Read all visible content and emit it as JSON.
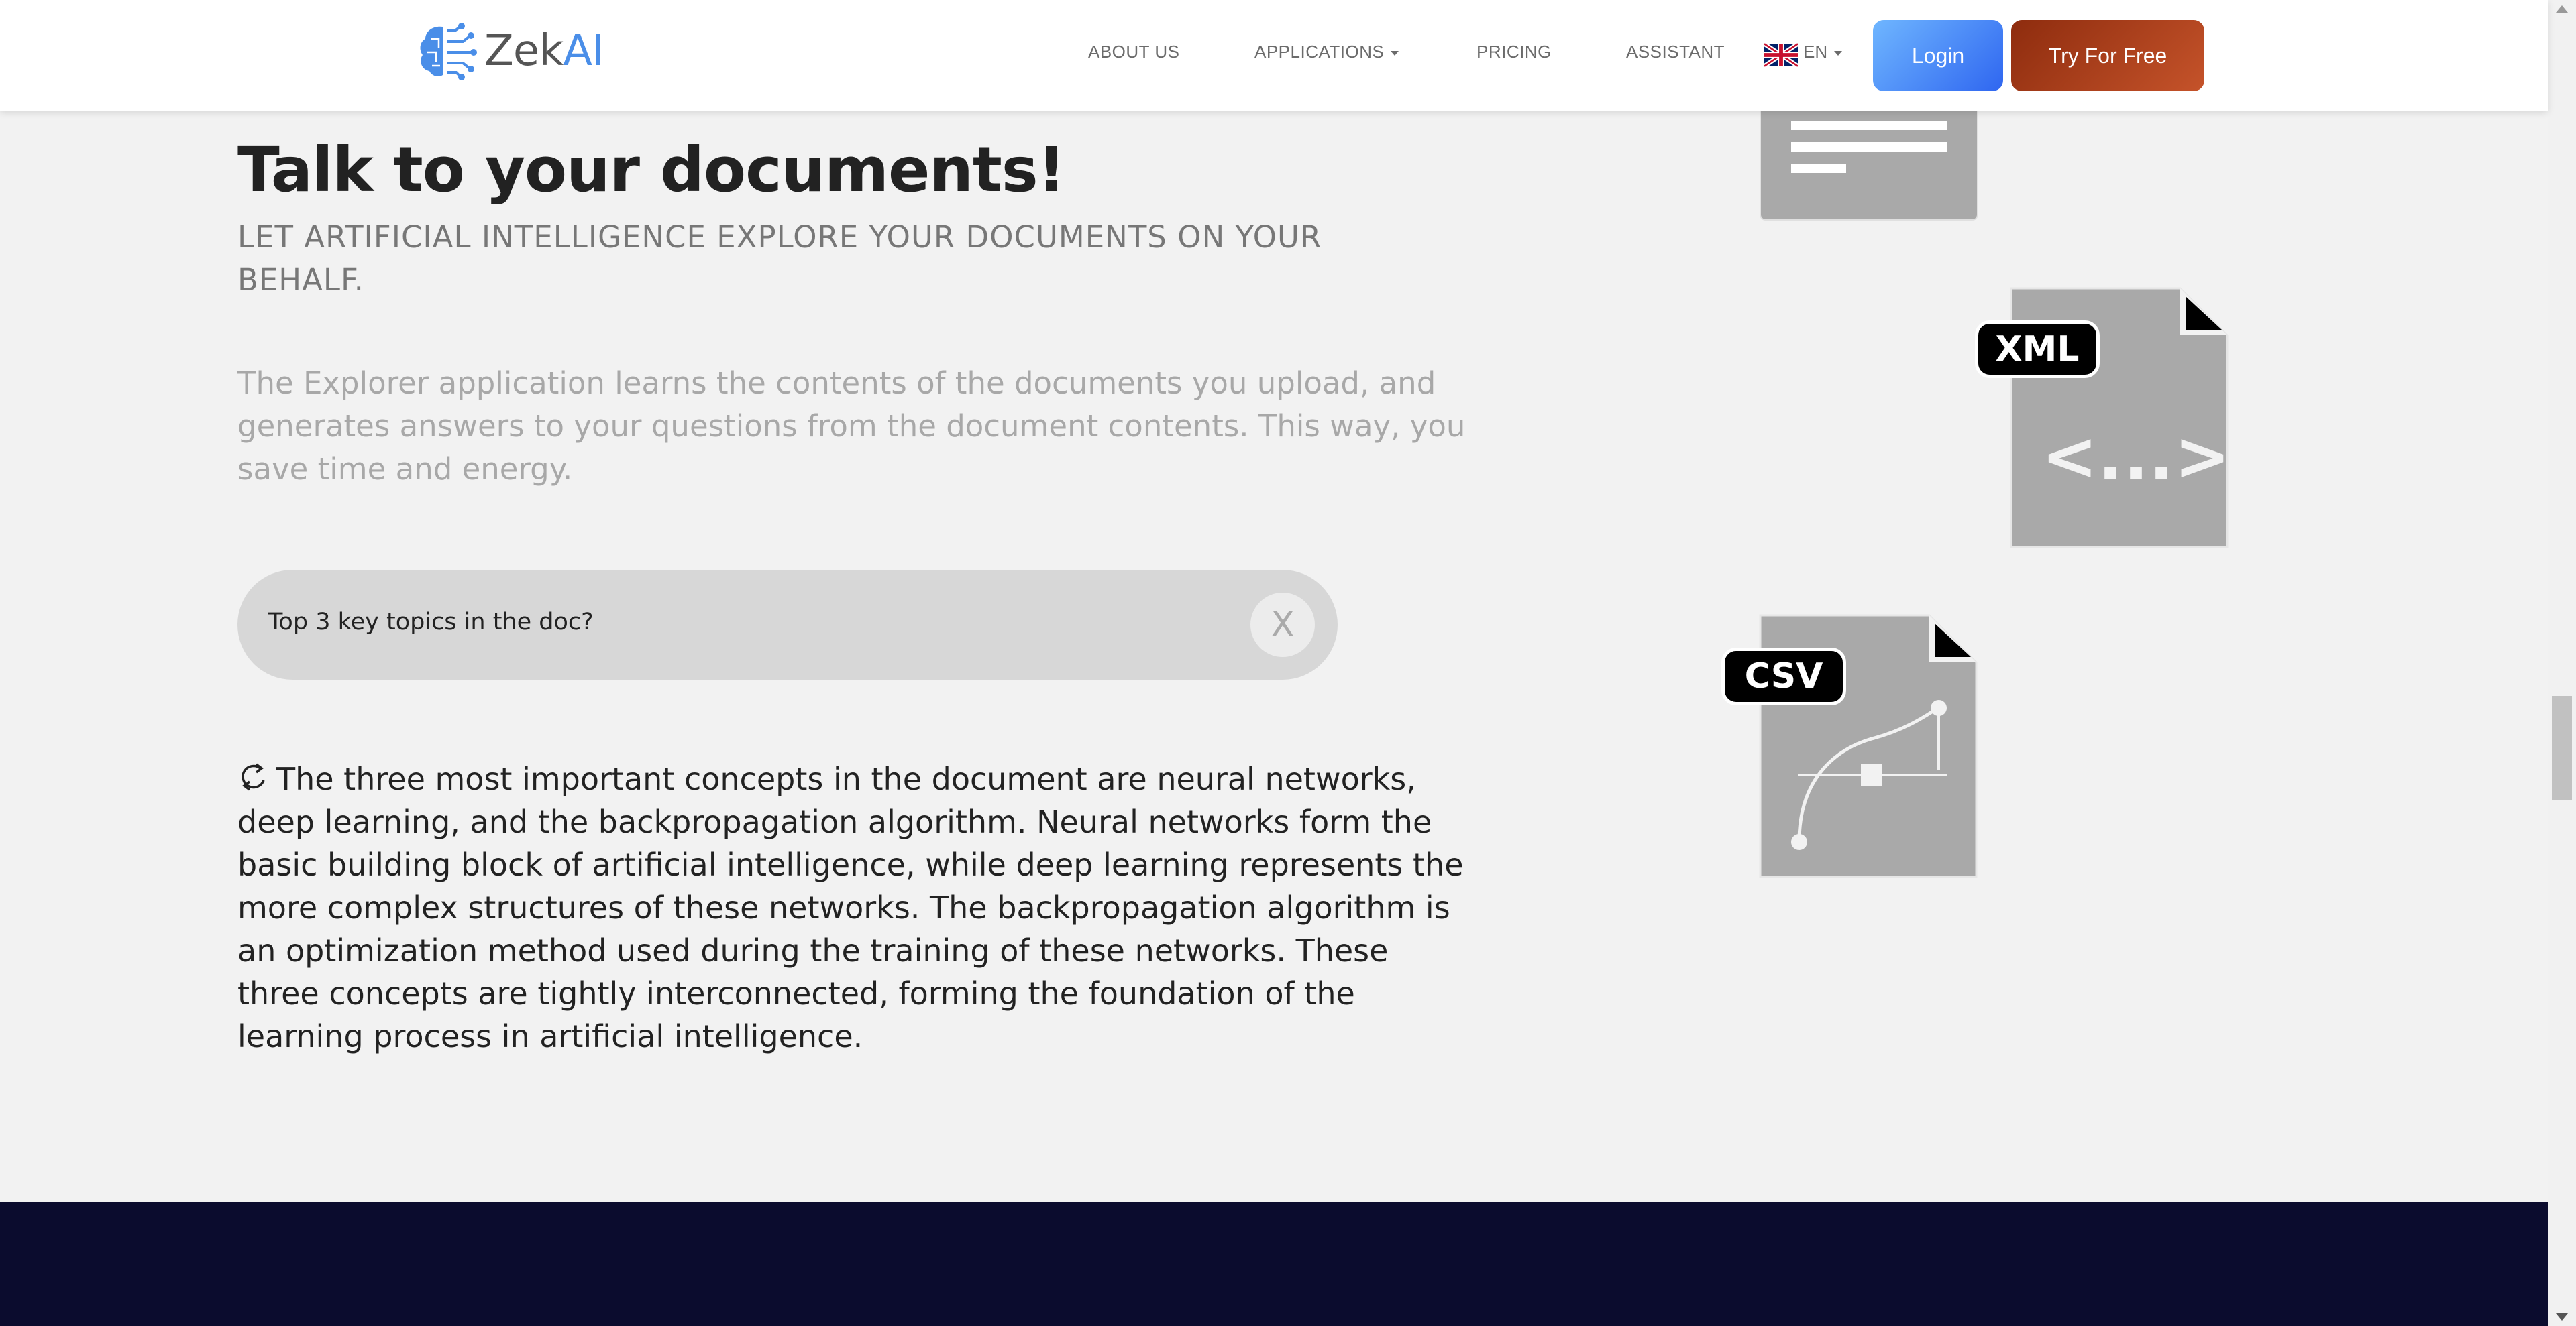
{
  "header": {
    "logo": {
      "text_zek": "Zek",
      "text_ai": "AI",
      "icon": "brain-circuit-icon"
    },
    "nav": {
      "about": "ABOUT US",
      "applications": "APPLICATIONS",
      "pricing": "PRICING",
      "assistant": "ASSISTANT"
    },
    "language": {
      "code": "EN",
      "flag": "uk-flag-icon"
    },
    "login_label": "Login",
    "try_label": "Try For Free"
  },
  "main": {
    "title": "Talk to your documents!",
    "subtitle": "LET ARTIFICIAL INTELLIGENCE EXPLORE YOUR DOCUMENTS ON YOUR BEHALF.",
    "description": "The Explorer application learns the contents of the documents you upload, and generates answers to your questions from the document contents. This way, you save time and energy.",
    "query": {
      "value": "Top 3 key topics in the doc?",
      "clear_label": "X"
    },
    "answer": "The three most important concepts in the document are neural networks, deep learning, and the backpropagation algorithm. Neural networks form the basic building block of artificial intelligence, while deep learning represents the more complex structures of these networks. The backpropagation algorithm is an optimization method used during the training of these networks. These three concepts are tightly interconnected, forming the foundation of the learning process in artificial intelligence."
  },
  "documents": {
    "xml": {
      "label": "XML",
      "glyph": "<...>"
    },
    "csv": {
      "label": "CSV"
    }
  },
  "colors": {
    "accent_blue": "#4a8ee8",
    "login_gradient": [
      "#6fb6ff",
      "#2f66f0"
    ],
    "try_gradient": [
      "#8e2c0e",
      "#c5532a"
    ],
    "footer": "#0b0c2e",
    "doc_gray": "#a9a9a9"
  }
}
